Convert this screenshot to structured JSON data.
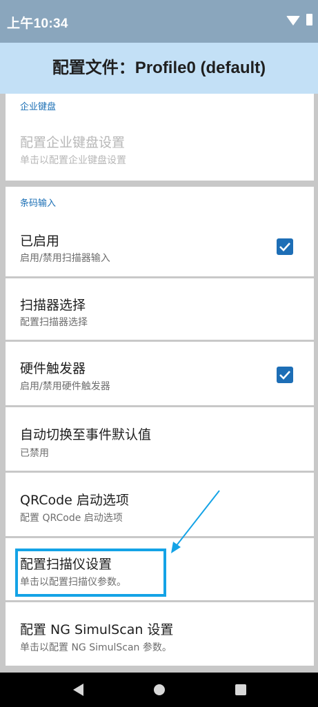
{
  "status_bar": {
    "time": "上午10:34"
  },
  "app_bar": {
    "title": "配置文件：Profile0 (default)"
  },
  "enterprise_keyboard": {
    "header": "企业键盘",
    "item": {
      "title": "配置企业键盘设置",
      "summary": "单击以配置企业键盘设置",
      "enabled": false
    }
  },
  "barcode_input": {
    "header": "条码输入",
    "items": [
      {
        "title": "已启用",
        "summary": "启用/禁用扫描器输入",
        "checked": true
      },
      {
        "title": "扫描器选择",
        "summary": "配置扫描器选择"
      },
      {
        "title": "硬件触发器",
        "summary": "启用/禁用硬件触发器",
        "checked": true
      },
      {
        "title": "自动切换至事件默认值",
        "summary": "已禁用"
      },
      {
        "title": "QRCode 启动选项",
        "summary": "配置 QRCode 启动选项"
      },
      {
        "title": "配置扫描仪设置",
        "summary": "单击以配置扫描仪参数。"
      },
      {
        "title": "配置 NG SimulScan 设置",
        "summary": "单击以配置 NG SimulScan 参数。"
      }
    ]
  },
  "colors": {
    "accent": "#1d6eb6",
    "header_text": "#1b6fb5",
    "highlight": "#14a3e6",
    "app_bar": "#c3e0f6",
    "status_bar": "#8aa6bd"
  },
  "icons": {
    "checkbox": "check-icon",
    "nav": [
      "nav-back-icon",
      "nav-home-icon",
      "nav-recents-icon"
    ]
  }
}
